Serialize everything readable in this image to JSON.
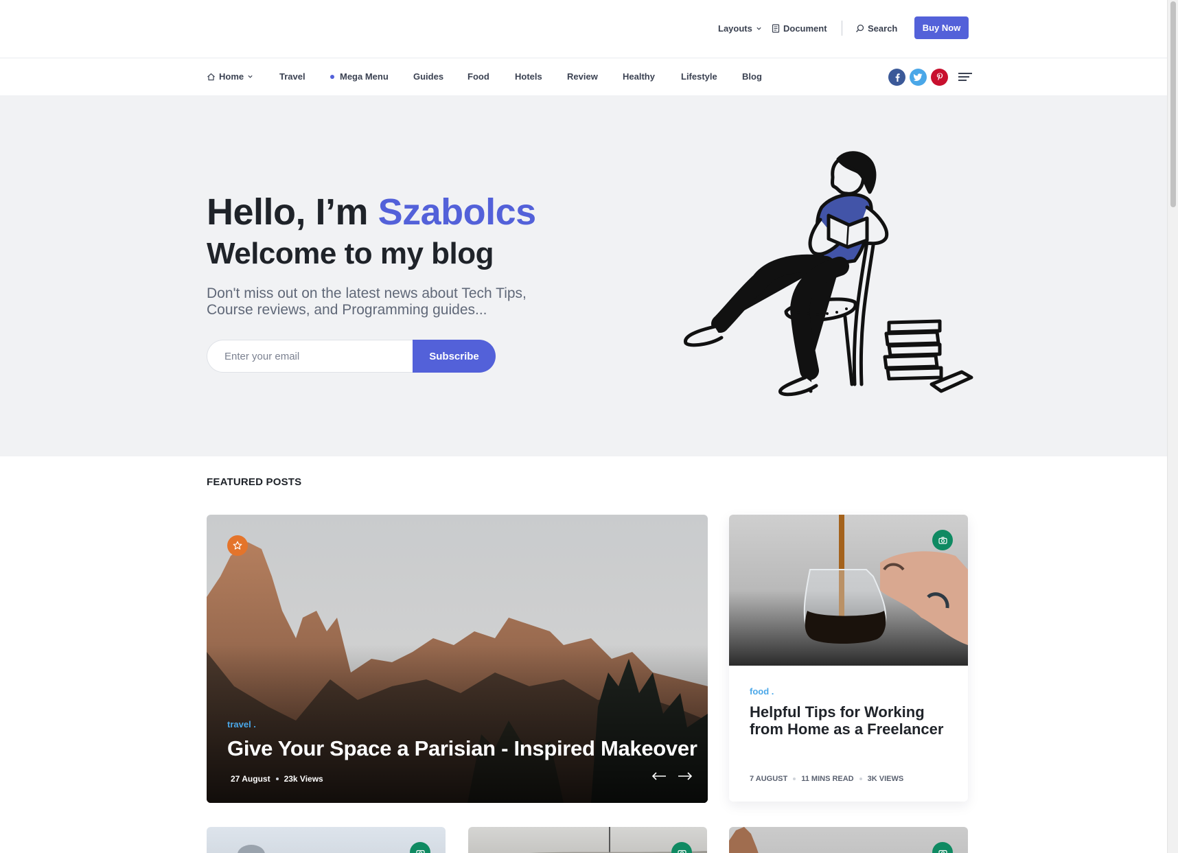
{
  "topbar": {
    "layouts": "Layouts",
    "document": "Document",
    "search": "Search",
    "buy_now": "Buy Now"
  },
  "nav": {
    "items": [
      "Home",
      "Travel",
      "Mega Menu",
      "Guides",
      "Food",
      "Hotels",
      "Review",
      "Healthy",
      "Lifestyle",
      "Blog"
    ],
    "social": [
      {
        "name": "facebook",
        "glyph": "f",
        "color": "#3b5998"
      },
      {
        "name": "twitter",
        "glyph": "t",
        "color": "#4aa7e8"
      },
      {
        "name": "pinterest",
        "glyph": "p",
        "color": "#c8102e"
      }
    ]
  },
  "hero": {
    "greeting": "Hello, I’m ",
    "name": "Szabolcs",
    "welcome": "Welcome to my blog",
    "description": "Don't miss out on the latest news about Tech Tips, Course reviews, and Programming guides...",
    "email_placeholder": "Enter your email",
    "subscribe": "Subscribe"
  },
  "featured": {
    "section_title": "FEATURED POSTS",
    "main_post": {
      "category": "travel .",
      "title": "Give Your Space a Parisian - Inspired Makeover",
      "date": "27 August",
      "views": "23k Views"
    },
    "side_post": {
      "category": "food .",
      "title": "Helpful Tips for Working from Home as a Freelancer",
      "date": "7 AUGUST",
      "read_time": "11 MINS READ",
      "views": "3K VIEWS"
    }
  },
  "colors": {
    "accent": "#5361d9",
    "category": "#4aa7e8",
    "badge_green": "#0f8a62",
    "badge_orange": "#e4742b"
  }
}
